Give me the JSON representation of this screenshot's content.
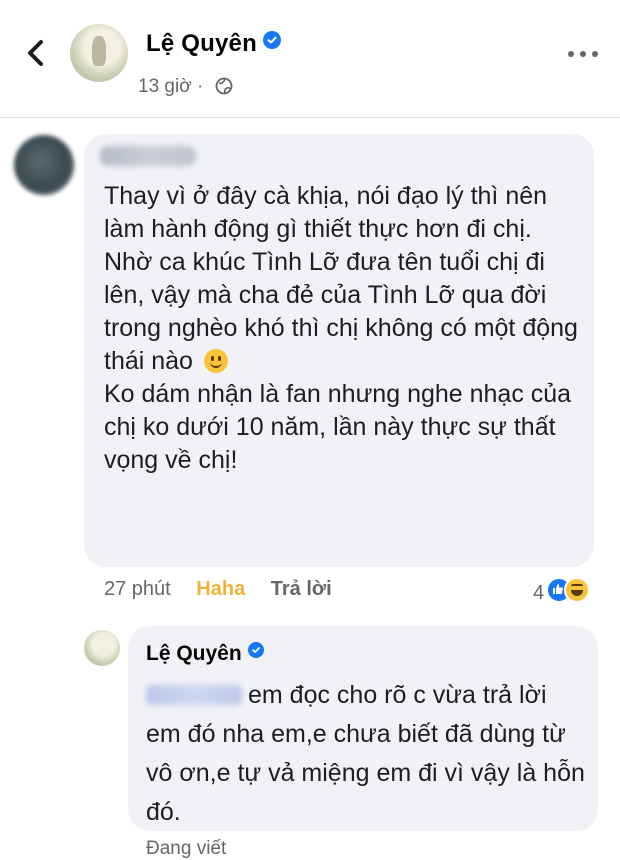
{
  "post": {
    "author": "Lệ Quyên",
    "time": "13 giờ",
    "privacy_icon": "globe-icon"
  },
  "comment": {
    "author_hidden": true,
    "paragraphs": [
      "Thay vì ở đây cà khịa, nói đạo lý thì nên làm hành động gì thiết thực hơn đi chị.",
      "Nhờ ca khúc Tình Lỡ đưa tên tuổi chị đi lên, vậy mà cha đẻ của Tình Lỡ qua đời trong nghèo khó thì chị không có một động thái nào",
      "Ko dám nhận là fan nhưng nghe nhạc của chị ko dưới 10 năm, lần này thực sự thất vọng về chị!"
    ],
    "time": "27 phút",
    "reaction_label": "Haha",
    "reply_label": "Trả lời",
    "reaction_count": "4"
  },
  "reply": {
    "author": "Lệ Quyên",
    "text": "em đọc cho rõ c vừa trả lời em đó nha em,e chưa biết đã dùng từ vô ơn,e tự vả miệng em đi vì vậy là hỗn đó.",
    "status": "Đang viết"
  },
  "colors": {
    "verified": "#1877f2",
    "haha": "#f0b33a",
    "bubble": "#f0f2f5"
  }
}
